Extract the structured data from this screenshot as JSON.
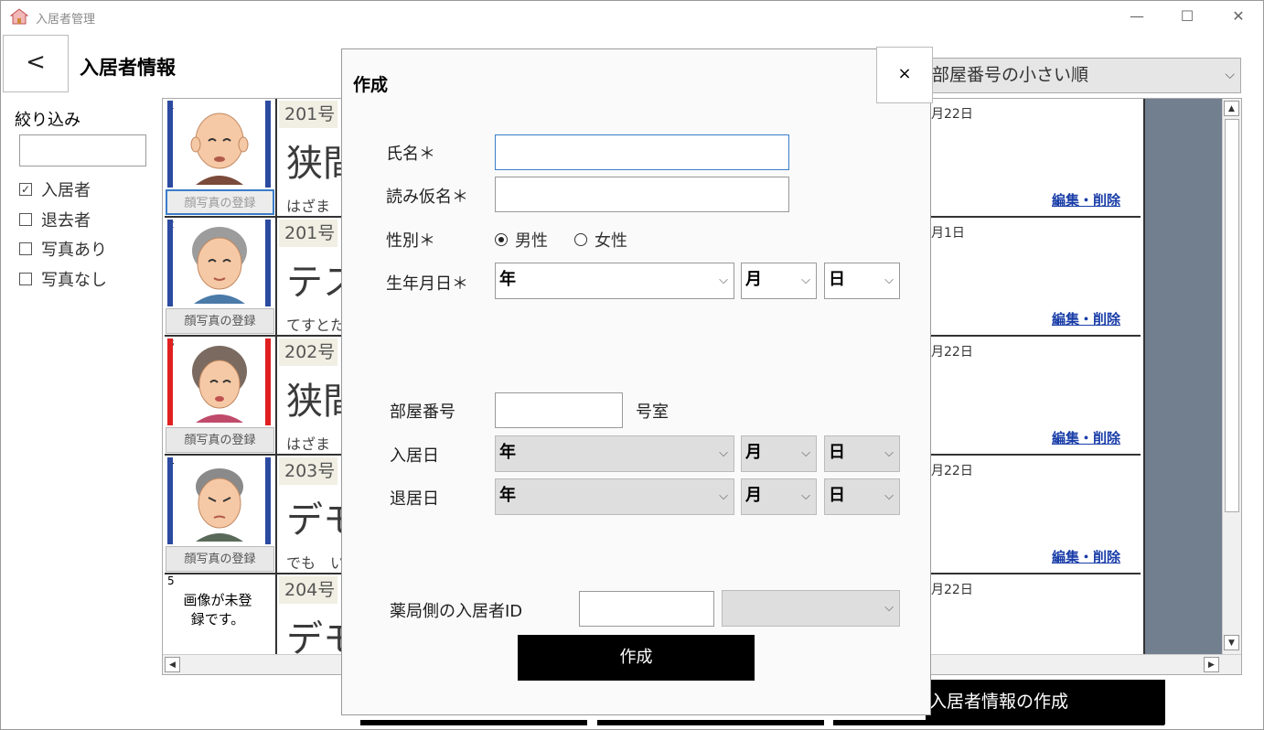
{
  "window": {
    "title": "入居者管理",
    "minimize": "—",
    "maximize": "☐",
    "close": "✕"
  },
  "header": {
    "back_label": "<",
    "page_title": "入居者情報"
  },
  "filter": {
    "label": "絞り込み",
    "search_value": "",
    "options": [
      {
        "label": "入居者",
        "checked": true,
        "mark": "✓"
      },
      {
        "label": "退去者",
        "checked": false,
        "mark": ""
      },
      {
        "label": "写真あり",
        "checked": false,
        "mark": ""
      },
      {
        "label": "写真なし",
        "checked": false,
        "mark": ""
      }
    ]
  },
  "sort": {
    "selected": "部屋番号の小さい順",
    "chevron": "⌵"
  },
  "residents": [
    {
      "index": "1",
      "room": "201号",
      "name": "狭間",
      "kana": "はざま",
      "date": "月22日",
      "photo_button": "顔写真の登録",
      "edit_label": "編集・削除",
      "bar_left": "#2b4aa0",
      "bar_right": "#2b4aa0"
    },
    {
      "index": "2",
      "room": "201号",
      "name": "テス",
      "kana": "てすとた",
      "date": "月1日",
      "photo_button": "顔写真の登録",
      "edit_label": "編集・削除",
      "bar_left": "#2b4aa0",
      "bar_right": "#2b4aa0"
    },
    {
      "index": "3",
      "room": "202号",
      "name": "狭間",
      "kana": "はざま",
      "date": "月22日",
      "photo_button": "顔写真の登録",
      "edit_label": "編集・削除",
      "bar_left": "#e02020",
      "bar_right": "#e02020"
    },
    {
      "index": "4",
      "room": "203号",
      "name": "デモ",
      "kana": "でも　い",
      "date": "月22日",
      "photo_button": "顔写真の登録",
      "edit_label": "編集・削除",
      "bar_left": "#2b4aa0",
      "bar_right": "#2b4aa0"
    },
    {
      "index": "5",
      "room": "204号",
      "name": "デモ",
      "kana": "",
      "date": "月22日",
      "no_image_text": "画像が未登録です。"
    }
  ],
  "footer": {
    "create_button": "入居者情報の作成"
  },
  "modal": {
    "title": "作成",
    "close_label": "×",
    "name_label": "氏名＊",
    "name_value": "",
    "kana_label": "読み仮名＊",
    "kana_value": "",
    "gender_label": "性別＊",
    "gender_male": "男性",
    "gender_female": "女性",
    "gender_selected": "男性",
    "birth_label": "生年月日＊",
    "year": "年",
    "month": "月",
    "day": "日",
    "room_label": "部屋番号",
    "room_value": "",
    "room_suffix": "号室",
    "movein_label": "入居日",
    "moveout_label": "退居日",
    "pharmacy_id_label": "薬局側の入居者ID",
    "pharmacy_id_value": "",
    "pharmacy_select": "",
    "submit_label": "作成",
    "chevron": "⌵"
  }
}
